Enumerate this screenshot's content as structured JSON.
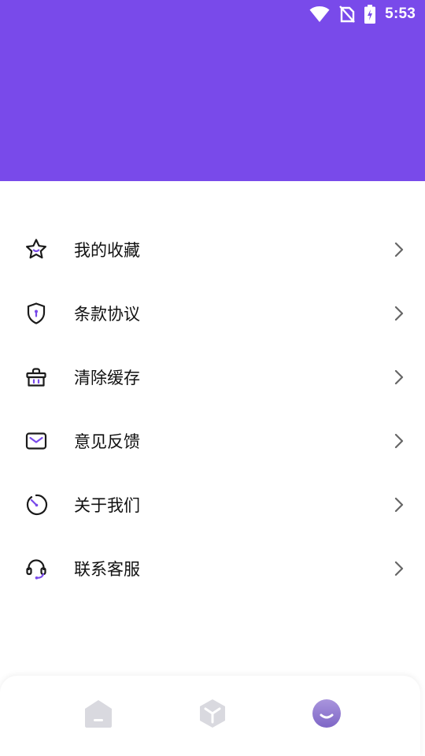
{
  "status_bar": {
    "time": "5:53",
    "icons": [
      "wifi-icon",
      "no-sim-icon",
      "battery-charging-icon"
    ]
  },
  "colors": {
    "accent": "#794aea",
    "header": "#794aea",
    "tab_inactive": "#d9d9df"
  },
  "menu": {
    "items": [
      {
        "label": "我的收藏",
        "icon": "star-icon"
      },
      {
        "label": "条款协议",
        "icon": "shield-icon"
      },
      {
        "label": "清除缓存",
        "icon": "basket-icon"
      },
      {
        "label": "意见反馈",
        "icon": "mail-icon"
      },
      {
        "label": "关于我们",
        "icon": "clock-icon"
      },
      {
        "label": "联系客服",
        "icon": "headset-icon"
      }
    ]
  },
  "tabbar": {
    "tabs": [
      {
        "icon": "home-icon",
        "active": false
      },
      {
        "icon": "cube-icon",
        "active": false
      },
      {
        "icon": "profile-icon",
        "active": true
      }
    ]
  }
}
